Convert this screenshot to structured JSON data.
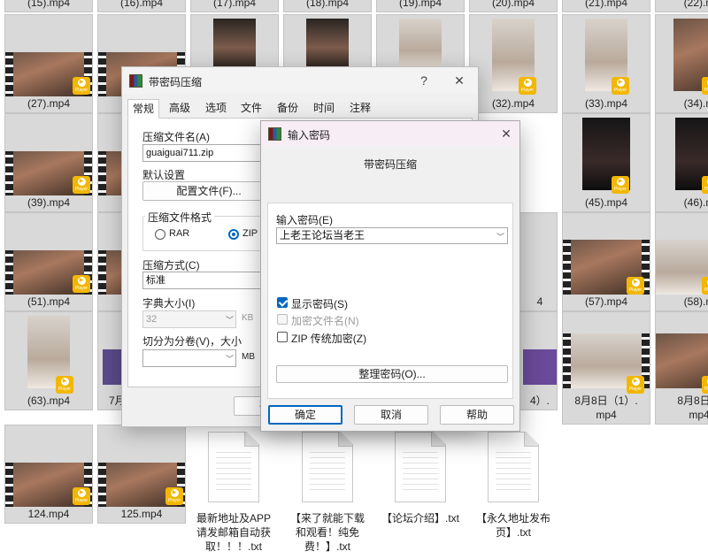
{
  "explorer": {
    "top_row_labels": [
      "(15).mp4",
      "(16).mp4",
      "(17).mp4",
      "(18).mp4",
      "(19).mp4",
      "(20).mp4",
      "(21).mp4",
      "(22).m"
    ],
    "videos": [
      {
        "label": "(27).mp4"
      },
      {
        "label": "(32).mp4"
      },
      {
        "label": "(33).mp4"
      },
      {
        "label": "(34).m"
      },
      {
        "label": "(39).mp4"
      },
      {
        "label": "(45).mp4"
      },
      {
        "label": "(46).m"
      },
      {
        "label": "(51).mp4"
      },
      {
        "label": "4"
      },
      {
        "label": "(57).mp4"
      },
      {
        "label": "(58).m"
      },
      {
        "label": "(63).mp4"
      },
      {
        "label": "7月"
      },
      {
        "label": "4）."
      },
      {
        "label": "8月8日（1）.",
        "label2": "mp4"
      },
      {
        "label": "8月8日（",
        "label2": "mp4"
      },
      {
        "label": "124.mp4"
      },
      {
        "label": "125.mp4"
      }
    ],
    "badge_text": "Player",
    "txt_files": [
      {
        "l1": "最新地址及APP",
        "l2": "请发邮箱自动获",
        "l3": "取！！！.txt"
      },
      {
        "l1": "【来了就能下载",
        "l2": "和观看！纯免",
        "l3": "费！】.txt"
      },
      {
        "l1": "【论坛介绍】.txt",
        "l2": "",
        "l3": ""
      },
      {
        "l1": "【永久地址发布",
        "l2": "页】.txt",
        "l3": ""
      }
    ]
  },
  "rar_dialog": {
    "title": "带密码压缩",
    "help": "?",
    "close": "✕",
    "tabs": [
      "常规",
      "高级",
      "选项",
      "文件",
      "备份",
      "时间",
      "注释"
    ],
    "archive_name_label": "压缩文件名(A)",
    "archive_name_value": "guaiguai711.zip",
    "default_settings_label": "默认设置",
    "profiles_button": "配置文件(F)...",
    "format_group": "压缩文件格式",
    "format_rar": "RAR",
    "format_zip": "ZIP",
    "method_label": "压缩方式(C)",
    "method_value": "标准",
    "dict_label": "字典大小(I)",
    "dict_value": "32",
    "dict_unit": "KB",
    "split_label": "切分为分卷(V)，大小",
    "split_value": "",
    "split_unit": "MB",
    "ok_partial": "确"
  },
  "pwd_dialog": {
    "title": "输入密码",
    "close": "✕",
    "subtitle": "带密码压缩",
    "enter_label": "输入密码(E)",
    "password_value": "上老王论坛当老王",
    "show_password": "显示密码(S)",
    "encrypt_names": "加密文件名(N)",
    "zip_legacy": "ZIP 传统加密(Z)",
    "organize_button": "整理密码(O)...",
    "ok": "确定",
    "cancel": "取消",
    "help": "帮助"
  },
  "colors": {
    "accent": "#0067c0",
    "badge": "#f2b700"
  }
}
